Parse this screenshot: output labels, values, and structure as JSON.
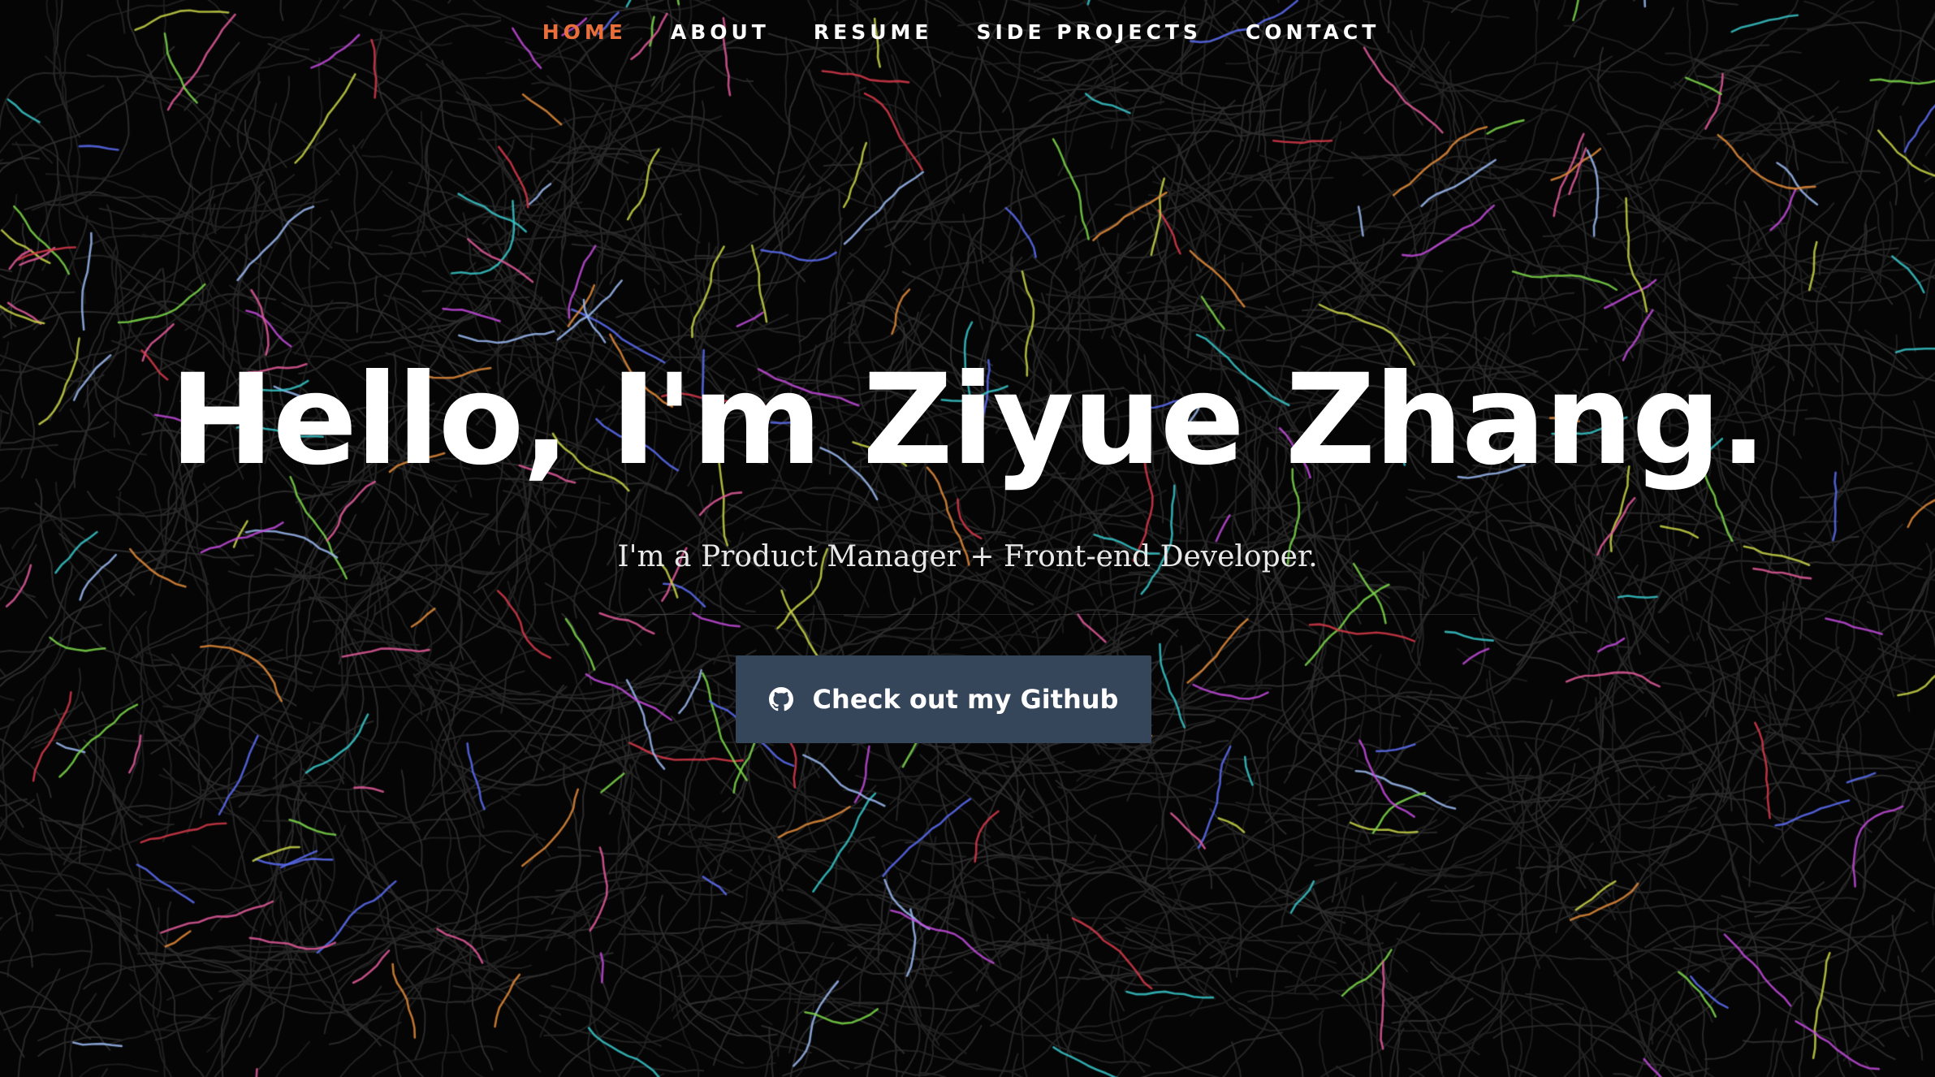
{
  "nav": {
    "items": [
      {
        "label": "HOME",
        "active": true
      },
      {
        "label": "ABOUT",
        "active": false
      },
      {
        "label": "RESUME",
        "active": false
      },
      {
        "label": "SIDE PROJECTS",
        "active": false
      },
      {
        "label": "CONTACT",
        "active": false
      }
    ],
    "active_color": "#e86f39",
    "text_color": "#ffffff"
  },
  "hero": {
    "title": "Hello, I'm Ziyue Zhang.",
    "subtitle": "I'm a Product Manager + Front-end Developer.",
    "button": {
      "label": "Check out my Github",
      "icon": "github-icon",
      "color": "#35455a"
    }
  },
  "background": {
    "color": "#050505",
    "line_color": "#2a2a2a",
    "accent_colors": [
      "#e05a9a",
      "#38c6c9",
      "#7bd64a",
      "#5a6cf0",
      "#c04ad8",
      "#e08a3a",
      "#d63a4a",
      "#c8d448",
      "#9ab8f0"
    ]
  }
}
